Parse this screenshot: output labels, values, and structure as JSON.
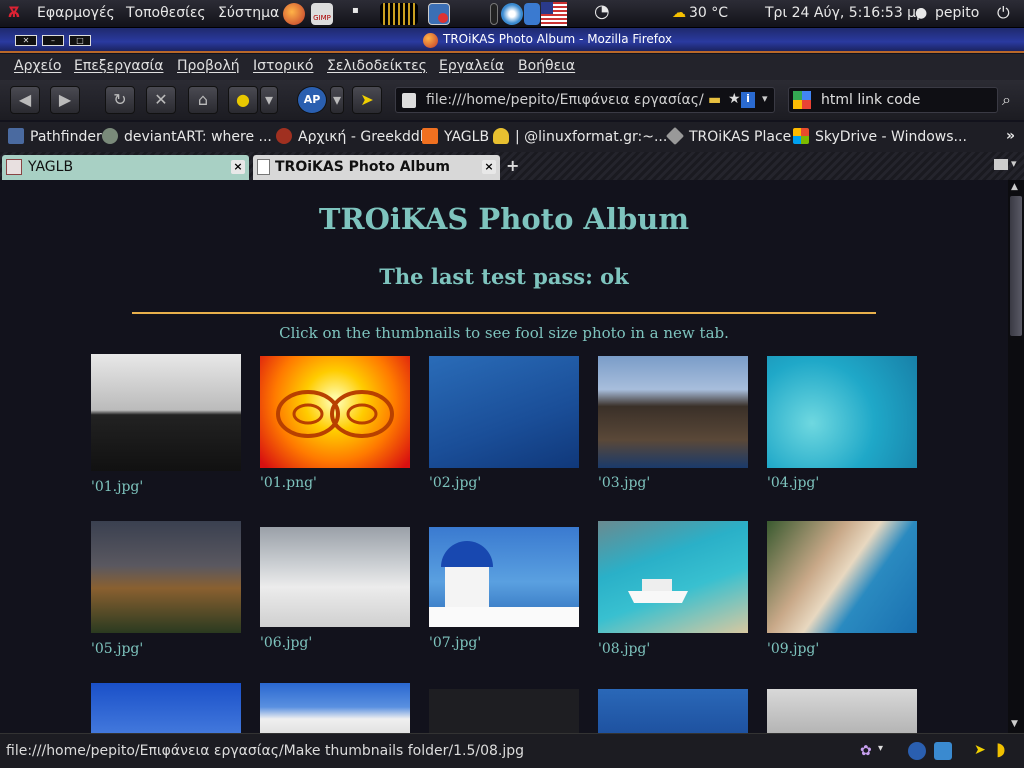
{
  "panel": {
    "menu_apps": "Εφαρμογές",
    "menu_places": "Τοποθεσίες",
    "menu_system": "Σύστημα",
    "weather": "30 °C",
    "datetime": "Τρι 24 Αύγ,  5:16:53 μμ",
    "user": "pepito"
  },
  "window": {
    "title": "TROiKAS Photo Album - Mozilla Firefox"
  },
  "menubar": {
    "file": "Αρχείο",
    "edit": "Επεξεργασία",
    "view": "Προβολή",
    "history": "Ιστορικό",
    "bookmarks": "Σελιδοδείκτες",
    "tools": "Εργαλεία",
    "help": "Βοήθεια"
  },
  "navbar": {
    "url": "file:///home/pepito/Επιφάνεια εργασίας/Ma",
    "search_value": "html link code"
  },
  "bookmarks": [
    {
      "label": "Pathfinder"
    },
    {
      "label": "deviantART: where ..."
    },
    {
      "label": "Αρχική - Greekddl"
    },
    {
      "label": "YAGLB"
    },
    {
      "label": "| @linuxformat.gr:~..."
    },
    {
      "label": "TROiKAS Place"
    },
    {
      "label": "SkyDrive - Windows..."
    }
  ],
  "tabs": [
    {
      "label": "YAGLB",
      "close": "×"
    },
    {
      "label": "TROiKAS Photo Album",
      "close": "×"
    }
  ],
  "page": {
    "title": "TROiKAS Photo Album",
    "subtitle": "The last test pass: ok",
    "instructions": "Click on the thumbnails to see fool size photo in a new tab.",
    "captions": [
      "'01.jpg'",
      "'01.png'",
      "'02.jpg'",
      "'03.jpg'",
      "'04.jpg'",
      "'05.jpg'",
      "'06.jpg'",
      "'07.jpg'",
      "'08.jpg'",
      "'09.jpg'"
    ]
  },
  "statusbar": {
    "text": "file:///home/pepito/Επιφάνεια εργασίας/Make thumbnails folder/1.5/08.jpg"
  },
  "colors": {
    "accent": "#7ec4be",
    "rule": "#e8b04c",
    "background": "#12121c"
  }
}
